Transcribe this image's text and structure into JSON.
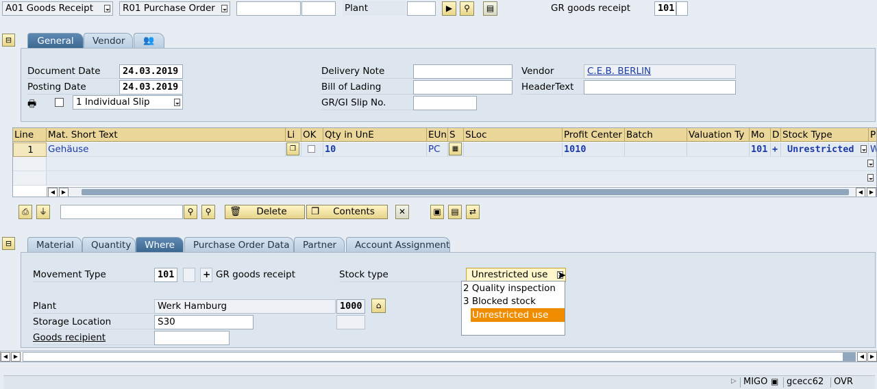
{
  "header": {
    "action_dropdown": "A01 Goods Receipt",
    "ref_dropdown": "R01 Purchase Order",
    "ref_input1": "",
    "ref_input2": "",
    "plant_label": "Plant",
    "plant_value": "",
    "gr_label": "GR goods receipt",
    "movement_type": "101",
    "movement_extra": ""
  },
  "header_tabs": [
    {
      "label": "General",
      "active": true
    },
    {
      "label": "Vendor",
      "active": false
    },
    {
      "label": "",
      "icon": "people-icon",
      "active": false
    }
  ],
  "general": {
    "document_date_label": "Document Date",
    "document_date": "24.03.2019",
    "posting_date_label": "Posting Date",
    "posting_date": "24.03.2019",
    "slip_option": "1 Individual Slip",
    "delivery_note_label": "Delivery Note",
    "delivery_note": "",
    "bill_of_lading_label": "Bill of Lading",
    "bill_of_lading": "",
    "gr_gi_slip_label": "GR/GI Slip No.",
    "gr_gi_slip": "",
    "vendor_label": "Vendor",
    "vendor": "C.E.B. BERLIN",
    "header_text_label": "HeaderText",
    "header_text": ""
  },
  "grid": {
    "columns": [
      "Line",
      "Mat. Short Text",
      "Li",
      "OK",
      "Qty in UnE",
      "EUn",
      "S",
      "SLoc",
      "Profit Center",
      "Batch",
      "Valuation Ty",
      "Mo",
      "D",
      "Stock Type",
      "Pl"
    ],
    "rows": [
      {
        "line": "1",
        "mat": "Gehäuse",
        "qty": "10",
        "eun": "PC",
        "sloc": "",
        "profit_center": "1010",
        "batch": "",
        "valuation": "",
        "mo": "101",
        "d": "+",
        "stock_type": "Unrestricted",
        "pl": "W"
      }
    ]
  },
  "toolbar": {
    "search_value": "",
    "delete_label": "Delete",
    "contents_label": "Contents"
  },
  "detail_tabs": [
    {
      "label": "Material",
      "active": false
    },
    {
      "label": "Quantity",
      "active": false
    },
    {
      "label": "Where",
      "active": true
    },
    {
      "label": "Purchase Order Data",
      "active": false
    },
    {
      "label": "Partner",
      "active": false
    },
    {
      "label": "Account Assignment",
      "active": false
    }
  ],
  "where": {
    "movement_type_label": "Movement Type",
    "movement_type": "101",
    "movement_sign": "+",
    "movement_desc": "GR goods receipt",
    "stock_type_label": "Stock type",
    "stock_type_value": "Unrestricted use",
    "stock_type_options": [
      "2 Quality inspection",
      "3 Blocked stock",
      "Unrestricted use"
    ],
    "plant_label": "Plant",
    "plant_name": "Werk Hamburg",
    "plant_code": "1000",
    "storage_location_label": "Storage Location",
    "storage_location": "S30",
    "goods_recipient_label": "Goods recipient",
    "goods_recipient": ""
  },
  "statusbar": {
    "transaction": "MIGO",
    "server": "gcecc62",
    "mode": "OVR"
  },
  "colors": {
    "active_tab": "#3c6892",
    "header_cell": "#ecd79a",
    "selected_option": "#f08c00",
    "panel": "#dde6ef"
  }
}
